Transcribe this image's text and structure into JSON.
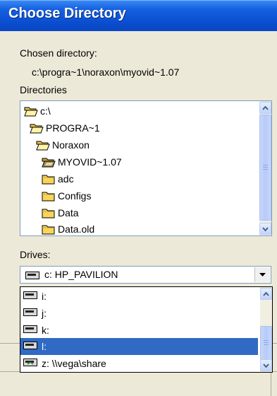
{
  "window": {
    "title": "Choose Directory"
  },
  "chosen": {
    "label": "Chosen directory:",
    "path": "c:\\progra~1\\noraxon\\myovid~1.07"
  },
  "directories": {
    "label": "Directories",
    "items": [
      {
        "label": "c:\\",
        "icon": "open-folder-icon"
      },
      {
        "label": "PROGRA~1",
        "icon": "open-folder-icon"
      },
      {
        "label": "Noraxon",
        "icon": "open-folder-icon"
      },
      {
        "label": "MYOVID~1.07",
        "icon": "open-folder-current-icon"
      },
      {
        "label": "adc",
        "icon": "folder-icon"
      },
      {
        "label": "Configs",
        "icon": "folder-icon"
      },
      {
        "label": "Data",
        "icon": "folder-icon"
      },
      {
        "label": "Data.old",
        "icon": "folder-icon"
      }
    ]
  },
  "drives": {
    "label": "Drives:",
    "selected": "c: HP_PAVILION",
    "options": [
      {
        "label": "i:",
        "icon": "drive-icon"
      },
      {
        "label": "j:",
        "icon": "drive-icon"
      },
      {
        "label": "k:",
        "icon": "drive-icon"
      },
      {
        "label": "l:",
        "icon": "drive-icon",
        "highlighted": true
      },
      {
        "label": "z: \\\\vega\\share",
        "icon": "network-drive-icon"
      }
    ]
  },
  "colors": {
    "titlebar": "#0a4fd0",
    "selection": "#316ac5",
    "dialog_bg": "#ece9d8"
  }
}
